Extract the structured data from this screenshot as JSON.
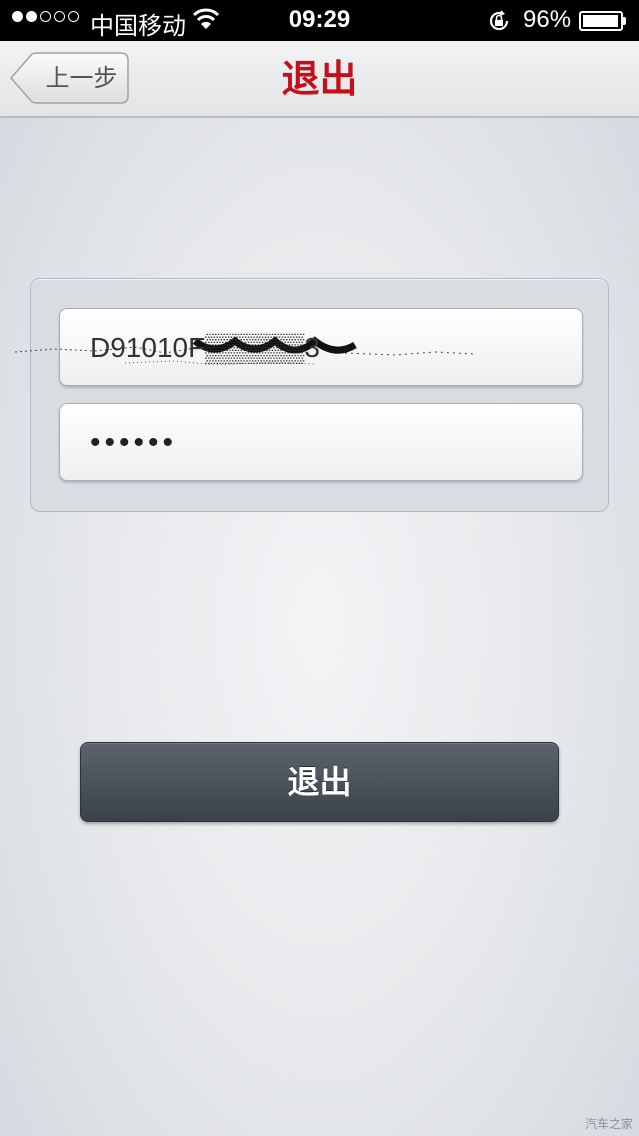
{
  "status_bar": {
    "carrier": "中国移动",
    "time": "09:29",
    "battery_percent": "96%",
    "battery_level": 0.96,
    "signal_bars": [
      true,
      true,
      false,
      false,
      false
    ]
  },
  "nav": {
    "back_label": "上一步",
    "title": "退出"
  },
  "form": {
    "username_value": "D91010F▒▒▒▒▒3",
    "password_value": "••••••"
  },
  "logout_button": {
    "label": "退出"
  },
  "watermark": "汽车之家",
  "colors": {
    "title_red": "#c3101b",
    "button_dark": "#434a54"
  },
  "icons": [
    "wifi-icon",
    "rotation-lock-icon",
    "battery-icon",
    "back-arrow-icon"
  ]
}
